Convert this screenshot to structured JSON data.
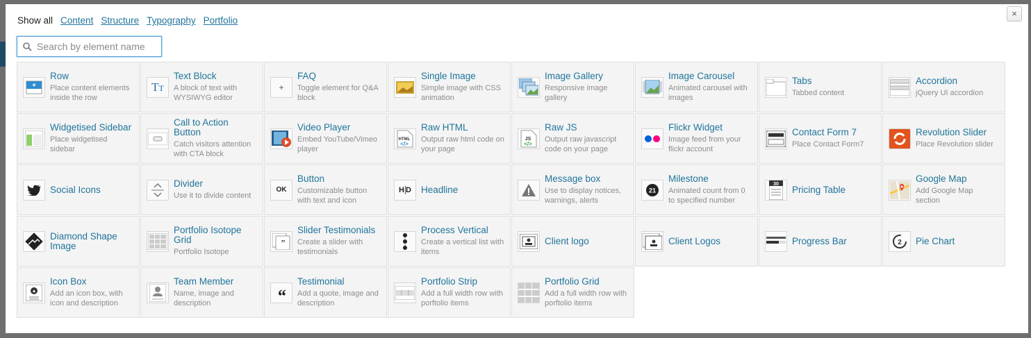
{
  "filters": [
    {
      "label": "Show all",
      "active": true
    },
    {
      "label": "Content",
      "active": false
    },
    {
      "label": "Structure",
      "active": false
    },
    {
      "label": "Typography",
      "active": false
    },
    {
      "label": "Portfolio",
      "active": false
    }
  ],
  "close_label": "×",
  "search": {
    "placeholder": "Search by element name",
    "value": ""
  },
  "elements": [
    {
      "title": "Row",
      "desc": "Place content elements inside the row",
      "icon": "row-icon"
    },
    {
      "title": "Text Block",
      "desc": "A block of text with WYSIWYG editor",
      "icon": "text-block-icon"
    },
    {
      "title": "FAQ",
      "desc": "Toggle element for Q&A block",
      "icon": "faq-icon"
    },
    {
      "title": "Single Image",
      "desc": "Simple image with CSS animation",
      "icon": "single-image-icon"
    },
    {
      "title": "Image Gallery",
      "desc": "Responsive image gallery",
      "icon": "image-gallery-icon"
    },
    {
      "title": "Image Carousel",
      "desc": "Animated carousel with images",
      "icon": "image-carousel-icon"
    },
    {
      "title": "Tabs",
      "desc": "Tabbed content",
      "icon": "tabs-icon"
    },
    {
      "title": "Accordion",
      "desc": "jQuery UI accordion",
      "icon": "accordion-icon"
    },
    {
      "title": "Widgetised Sidebar",
      "desc": "Place widgetised sidebar",
      "icon": "sidebar-icon"
    },
    {
      "title": "Call to Action Button",
      "desc": "Catch visitors attention with CTA block",
      "icon": "cta-button-icon"
    },
    {
      "title": "Video Player",
      "desc": "Embed YouTube/Vimeo player",
      "icon": "video-player-icon"
    },
    {
      "title": "Raw HTML",
      "desc": "Output raw html code on your page",
      "icon": "raw-html-icon"
    },
    {
      "title": "Raw JS",
      "desc": "Output raw javascript code on your page",
      "icon": "raw-js-icon"
    },
    {
      "title": "Flickr Widget",
      "desc": "Image feed from your flickr account",
      "icon": "flickr-icon"
    },
    {
      "title": "Contact Form 7",
      "desc": "Place Contact Form7",
      "icon": "contact-form-icon"
    },
    {
      "title": "Revolution Slider",
      "desc": "Place Revolution slider",
      "icon": "revolution-slider-icon"
    },
    {
      "title": "Social Icons",
      "desc": "",
      "icon": "twitter-bird-icon"
    },
    {
      "title": "Divider",
      "desc": "Use it to divide content",
      "icon": "divider-icon"
    },
    {
      "title": "Button",
      "desc": "Customizable button with text and icon",
      "icon": "ok-button-icon"
    },
    {
      "title": "Headline",
      "desc": "",
      "icon": "headline-icon"
    },
    {
      "title": "Message box",
      "desc": "Use to display notices, warnings, alerts",
      "icon": "warning-icon"
    },
    {
      "title": "Milestone",
      "desc": "Animated count from 0 to specified number",
      "icon": "milestone-icon"
    },
    {
      "title": "Pricing Table",
      "desc": "",
      "icon": "pricing-table-icon"
    },
    {
      "title": "Google Map",
      "desc": "Add Google Map section",
      "icon": "map-icon"
    },
    {
      "title": "Diamond Shape Image",
      "desc": "",
      "icon": "diamond-image-icon"
    },
    {
      "title": "Portfolio Isotope Grid",
      "desc": "Portfolio Isotope",
      "icon": "isotope-grid-icon"
    },
    {
      "title": "Slider Testimonials",
      "desc": "Create a slider with testimonials",
      "icon": "slider-testimonials-icon"
    },
    {
      "title": "Process Vertical",
      "desc": "Create a vertical list with items",
      "icon": "process-vertical-icon"
    },
    {
      "title": "Client logo",
      "desc": "",
      "icon": "client-logo-icon"
    },
    {
      "title": "Client Logos",
      "desc": "",
      "icon": "client-logos-icon"
    },
    {
      "title": "Progress Bar",
      "desc": "",
      "icon": "progress-bar-icon"
    },
    {
      "title": "Pie Chart",
      "desc": "",
      "icon": "pie-chart-icon"
    },
    {
      "title": "Icon Box",
      "desc": "Add an icon box, with icon and description",
      "icon": "icon-box-icon"
    },
    {
      "title": "Team Member",
      "desc": "Name, image and description",
      "icon": "team-member-icon"
    },
    {
      "title": "Testimonial",
      "desc": "Add a quote, image and description",
      "icon": "quote-icon"
    },
    {
      "title": "Portfolio Strip",
      "desc": "Add a full width row with porftolio items",
      "icon": "portfolio-strip-icon"
    },
    {
      "title": "Portfolio Grid",
      "desc": "Add a full width row with porftolio items",
      "icon": "portfolio-grid-icon"
    }
  ]
}
